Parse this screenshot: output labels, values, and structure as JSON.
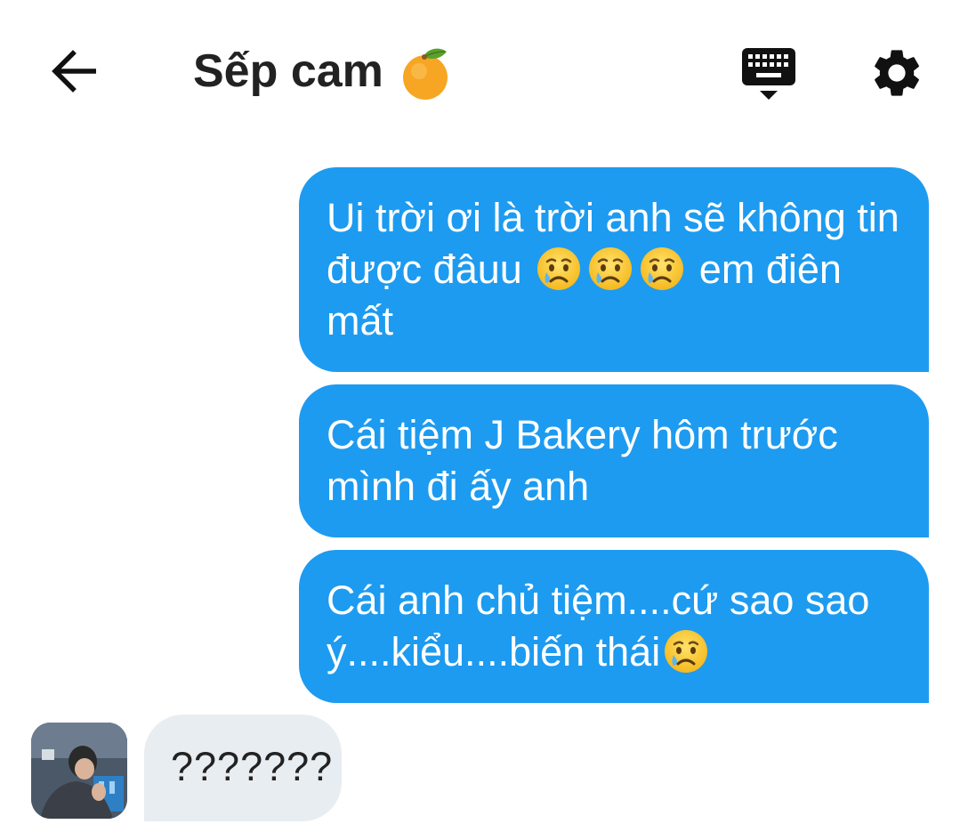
{
  "header": {
    "title": "Sếp cam",
    "back_icon": "arrow-left-icon",
    "title_icon": "tangerine-emoji",
    "keyboard_icon": "keyboard-icon",
    "settings_icon": "gear-icon"
  },
  "messages": [
    {
      "direction": "outgoing",
      "parts": [
        "Ui trời ơi là trời anh sẽ không tin được đâuu",
        " em điên mất"
      ],
      "emoji": "crying-face-emoji",
      "emoji_count": 3
    },
    {
      "direction": "outgoing",
      "parts": [
        "Cái tiệm J Bakery hôm trước mình đi ấy anh"
      ]
    },
    {
      "direction": "outgoing",
      "parts": [
        "Cái anh chủ tiệm....cứ sao sao ý....kiểu....biến thái"
      ],
      "emoji": "crying-face-emoji",
      "emoji_count": 1
    },
    {
      "direction": "incoming",
      "parts": [
        "???????"
      ],
      "avatar": "contact-avatar"
    }
  ],
  "colors": {
    "outgoing_bubble": "#1d9bf0",
    "incoming_bubble": "#e8edf1",
    "text_dark": "#222222",
    "text_light": "#ffffff"
  }
}
